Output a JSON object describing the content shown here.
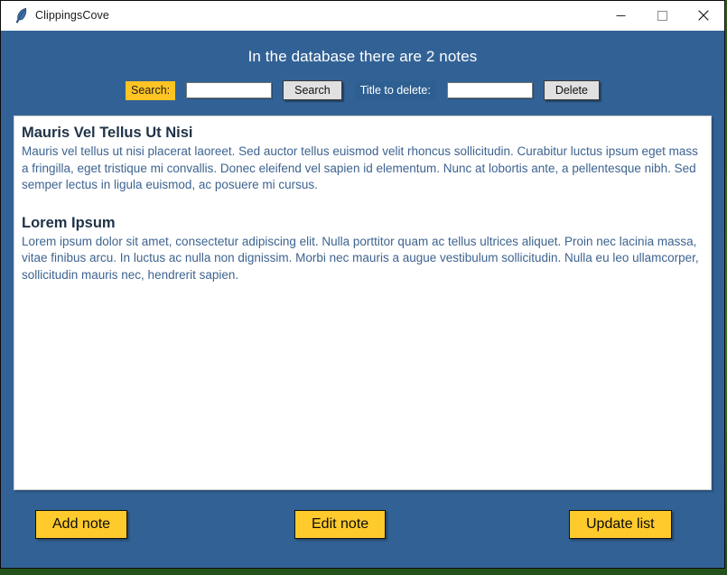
{
  "window": {
    "title": "ClippingsCove",
    "icon": "feather-quill-icon",
    "background_color": "#326295",
    "controls": {
      "minimize": "Minimize",
      "maximize": "Maximize",
      "close": "Close"
    }
  },
  "header": {
    "status_text": "In the database there are 2 notes",
    "note_count": 2
  },
  "toolbar": {
    "search_label": "Search:",
    "search_label_bg": "#ffc423",
    "search_value": "",
    "search_placeholder": "",
    "search_button": "Search",
    "delete_label": "Title to delete:",
    "delete_label_bg": "#2e5f91",
    "delete_value": "",
    "delete_placeholder": "",
    "delete_button": "Delete"
  },
  "notes": [
    {
      "title": "Mauris Vel Tellus Ut Nisi",
      "body": "Mauris vel tellus ut nisi placerat laoreet. Sed auctor tellus euismod velit rhoncus sollicitudin. Curabitur luctus ipsum eget massa fringilla, eget tristique mi convallis. Donec eleifend vel sapien id elementum. Nunc at lobortis ante, a pellentesque nibh. Sed semper lectus in ligula euismod, ac posuere mi cursus."
    },
    {
      "title": "Lorem Ipsum",
      "body": "Lorem ipsum dolor sit amet, consectetur adipiscing elit. Nulla porttitor quam ac tellus ultrices aliquet. Proin nec lacinia massa, vitae finibus arcu. In luctus ac nulla non dignissim. Morbi nec mauris a augue vestibulum sollicitudin. Nulla eu leo ullamcorper, sollicitudin mauris nec, hendrerit sapien."
    }
  ],
  "actions": {
    "add_note": "Add note",
    "edit_note": "Edit note",
    "update_list": "Update list",
    "button_color": "#ffca2c"
  }
}
